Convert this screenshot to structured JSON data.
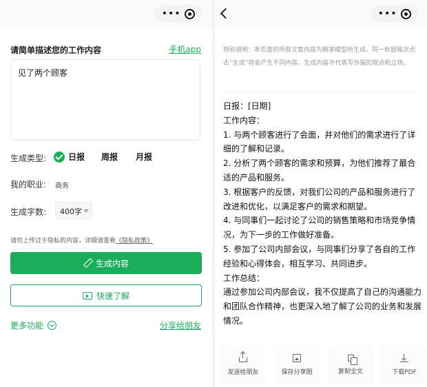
{
  "left": {
    "prompt_label": "请简单描述您的工作内容",
    "app_link": "手机app",
    "input_value": "见了两个顾客",
    "type_label": "生成类型:",
    "types": [
      {
        "label": "日报",
        "selected": true
      },
      {
        "label": "周报",
        "selected": false
      },
      {
        "label": "月报",
        "selected": false
      }
    ],
    "job_label": "我的职业:",
    "job_value": "商务",
    "count_label": "生成字数:",
    "count_value": "400字",
    "notice_text": "请勿上传过于隐私的内容，详细请查看",
    "notice_link": "《隐私政策》",
    "generate_button": "生成内容",
    "learn_button": "快速了解",
    "more_label": "更多功能",
    "share_link": "分享给朋友"
  },
  "right": {
    "disclaimer": "特别说明：本页面的所有文章内容为概率模型所生成。同一标题每次点击“生成”将会产生不同内容。生成内容不代表写作猫的观点和立场。",
    "lines": [
      "日报：[日期]",
      "工作内容：",
      "1. 与两个顾客进行了会面，并对他们的需求进行了详细的了解和记录。",
      "2. 分析了两个顾客的需求和预算，为他们推荐了最合适的产品和服务。",
      "3. 根据客户的反馈，对我们公司的产品和服务进行了改进和优化，以满足客户的需求和期望。",
      "4. 与同事们一起讨论了公司的销售策略和市场竞争情况，为下一步的工作做好准备。",
      "5. 参加了公司内部会议，与同事们分享了各自的工作经验和心得体会，相互学习、共同进步。",
      "工作总结：",
      "通过参加公司内部会议，我不仅提高了自己的沟通能力和团队合作精神，也更深入地了解了公司的业务和发展情况。"
    ],
    "actions": [
      {
        "label": "发送给朋友",
        "icon": "share-icon"
      },
      {
        "label": "保存分享图",
        "icon": "image-icon"
      },
      {
        "label": "复制全文",
        "icon": "copy-icon"
      },
      {
        "label": "下载PDF",
        "icon": "download-icon"
      }
    ]
  },
  "colors": {
    "accent": "#1aad5a"
  }
}
